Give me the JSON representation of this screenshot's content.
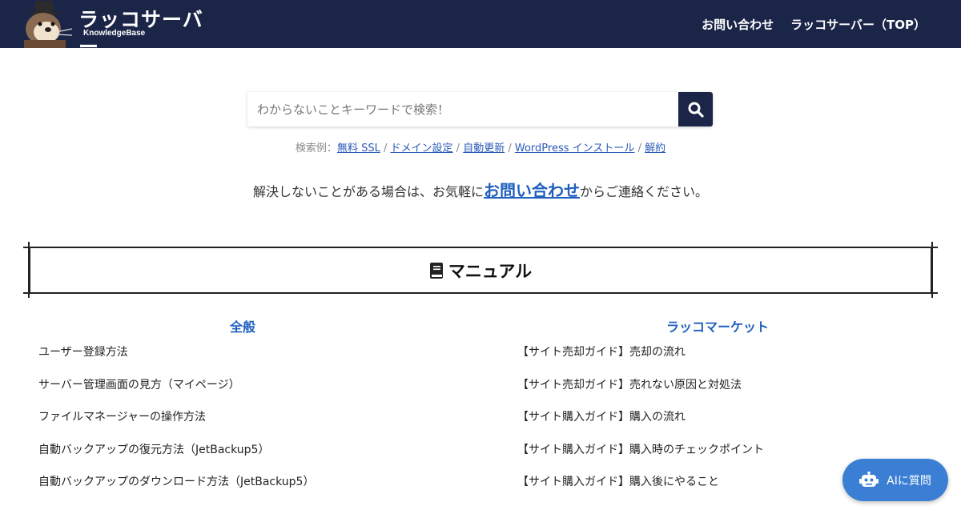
{
  "header": {
    "brand_title": "ラッコサーバー",
    "brand_sub": "KnowledgeBase",
    "nav": [
      {
        "label": "お問い合わせ"
      },
      {
        "label": "ラッコサーバー（TOP）"
      }
    ],
    "bg_color": "#1b2547"
  },
  "search": {
    "placeholder": "わからないことキーワードで検索！",
    "value": ""
  },
  "examples": {
    "prefix": "検索例：",
    "links": [
      "無料 SSL",
      "ドメイン設定",
      "自動更新",
      "WordPress インストール",
      "解約"
    ],
    "separator": "/"
  },
  "contact": {
    "before": "解決しないことがある場合は、お気軽に",
    "link": "お問い合わせ",
    "after": "からご連絡ください。"
  },
  "manual": {
    "title": "マニュアル",
    "icon": "book-icon"
  },
  "sections": {
    "left": {
      "heading": "全般",
      "items": [
        "ユーザー登録方法",
        "サーバー管理画面の見方（マイページ）",
        "ファイルマネージャーの操作方法",
        "自動バックアップの復元方法（JetBackup5）",
        "自動バックアップのダウンロード方法（JetBackup5）"
      ]
    },
    "right": {
      "heading": "ラッコマーケット",
      "items": [
        "【サイト売却ガイド】売却の流れ",
        "【サイト売却ガイド】売れない原因と対処法",
        "【サイト購入ガイド】購入の流れ",
        "【サイト購入ガイド】購入時のチェックポイント",
        "【サイト購入ガイド】購入後にやること"
      ]
    }
  },
  "chat": {
    "label": "AIに質問",
    "icon": "robot-icon",
    "color": "#3b7fd4"
  },
  "colors": {
    "accent_link": "#1f5fbf",
    "navy": "#1b2547"
  }
}
